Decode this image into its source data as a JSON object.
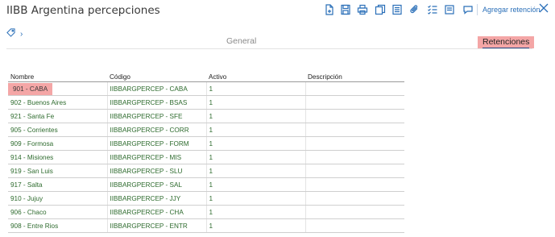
{
  "window": {
    "title": "IIBB Argentina percepciones"
  },
  "toolbar": {
    "icons": [
      "new-document-icon",
      "save-icon",
      "print-icon",
      "copy-icon",
      "attach-icon",
      "checklist-icon",
      "note-icon",
      "comment-icon"
    ],
    "agregar_label": "Agregar retención",
    "accent": "#2a6fb8"
  },
  "tags": {
    "chevron": "›"
  },
  "tabs": [
    {
      "label": "General",
      "active": false
    },
    {
      "label": "Retenciones",
      "active": true
    }
  ],
  "table": {
    "headers": [
      "Nombre",
      "Código",
      "Activo",
      "Descripción"
    ],
    "rows": [
      {
        "nombre": "901 - CABA",
        "codigo": "IIBBARGPERCEP - CABA",
        "activo": "1",
        "descripcion": ""
      },
      {
        "nombre": "902 - Buenos Aires",
        "codigo": "IIBBARGPERCEP - BSAS",
        "activo": "1",
        "descripcion": ""
      },
      {
        "nombre": "921 - Santa Fe",
        "codigo": "IIBBARGPERCEP - SFE",
        "activo": "1",
        "descripcion": ""
      },
      {
        "nombre": "905 - Corrientes",
        "codigo": "IIBBARGPERCEP - CORR",
        "activo": "1",
        "descripcion": ""
      },
      {
        "nombre": "909 - Formosa",
        "codigo": "IIBBARGPERCEP - FORM",
        "activo": "1",
        "descripcion": ""
      },
      {
        "nombre": "914 - Misiones",
        "codigo": "IIBBARGPERCEP - MIS",
        "activo": "1",
        "descripcion": ""
      },
      {
        "nombre": "919 - San Luis",
        "codigo": "IIBBARGPERCEP - SLU",
        "activo": "1",
        "descripcion": ""
      },
      {
        "nombre": "917 - Salta",
        "codigo": "IIBBARGPERCEP - SAL",
        "activo": "1",
        "descripcion": ""
      },
      {
        "nombre": "910 - Jujuy",
        "codigo": "IIBBARGPERCEP - JJY",
        "activo": "1",
        "descripcion": ""
      },
      {
        "nombre": "906 - Chaco",
        "codigo": "IIBBARGPERCEP - CHA",
        "activo": "1",
        "descripcion": ""
      },
      {
        "nombre": "908 - Entre Rios",
        "codigo": "IIBBARGPERCEP - ENTR",
        "activo": "1",
        "descripcion": ""
      }
    ]
  }
}
